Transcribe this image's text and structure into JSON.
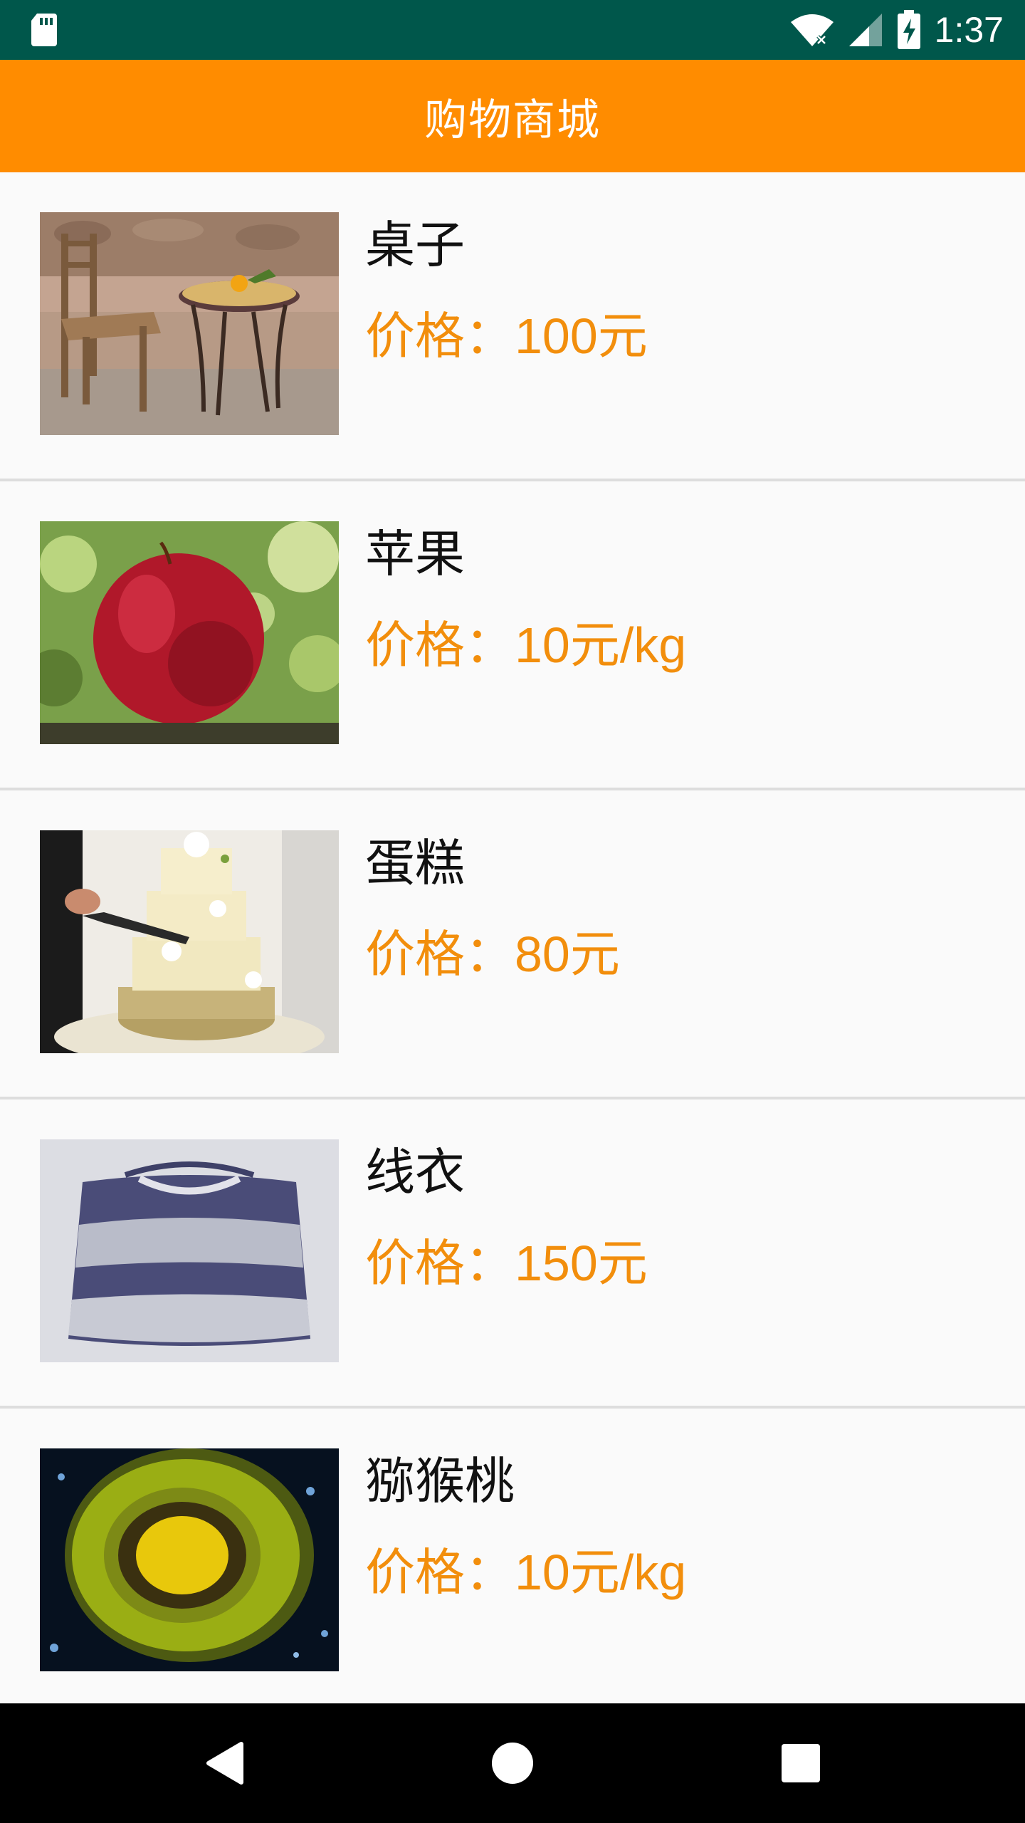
{
  "status_bar": {
    "time": "1:37",
    "icons": [
      "sd-card-icon",
      "wifi-icon",
      "signal-icon",
      "battery-charging-icon"
    ]
  },
  "app_bar": {
    "title": "购物商城"
  },
  "products": [
    {
      "name": "桌子",
      "price": "价格：100元",
      "image_icon": "table-chair-image"
    },
    {
      "name": "苹果",
      "price": "价格：10元/kg",
      "image_icon": "apple-image"
    },
    {
      "name": "蛋糕",
      "price": "价格：80元",
      "image_icon": "cake-image"
    },
    {
      "name": "线衣",
      "price": "价格：150元",
      "image_icon": "sweater-image"
    },
    {
      "name": "猕猴桃",
      "price": "价格：10元/kg",
      "image_icon": "kiwi-image"
    }
  ],
  "nav_bar": {
    "buttons": [
      "back-icon",
      "home-icon",
      "recents-icon"
    ]
  },
  "colors": {
    "status_bar": "#00574b",
    "app_bar": "#ff8c00",
    "price_text": "#f28e0c",
    "background": "#fafafa",
    "divider": "#dddddd"
  }
}
